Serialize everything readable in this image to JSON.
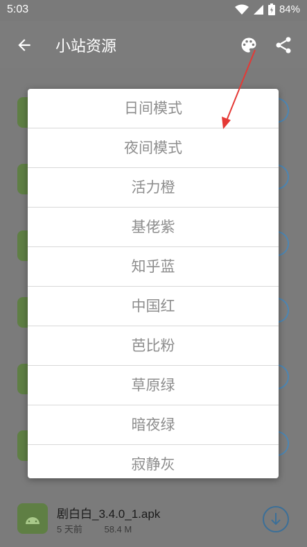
{
  "status_bar": {
    "time": "5:03",
    "battery": "84%"
  },
  "app_bar": {
    "title": "小站资源",
    "back_icon": "arrow-left-icon",
    "palette_icon": "palette-icon",
    "share_icon": "share-icon"
  },
  "menu": {
    "items": [
      {
        "label": "日间模式"
      },
      {
        "label": "夜间模式"
      },
      {
        "label": "活力橙"
      },
      {
        "label": "基佬紫"
      },
      {
        "label": "知乎蓝"
      },
      {
        "label": "中国红"
      },
      {
        "label": "芭比粉"
      },
      {
        "label": "草原绿"
      },
      {
        "label": "暗夜绿"
      },
      {
        "label": "寂静灰"
      }
    ]
  },
  "file_list": {
    "last_item": {
      "name": "剧白白_3.4.0_1.apk",
      "age": "5 天前",
      "size": "58.4 M"
    }
  },
  "colors": {
    "accent": "#2196F3",
    "annotation_arrow": "#e53935",
    "android_green": "#8bc34a"
  }
}
